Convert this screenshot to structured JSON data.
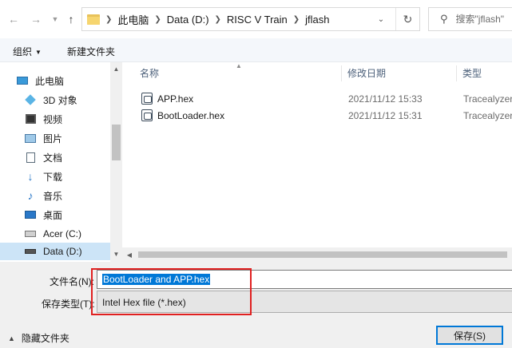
{
  "address": {
    "breadcrumbs": [
      "此电脑",
      "Data (D:)",
      "RISC V Train",
      "jflash"
    ],
    "search_placeholder": "搜索\"jflash\""
  },
  "toolbar": {
    "organize_label": "组织",
    "new_folder_label": "新建文件夹"
  },
  "nav": {
    "items": [
      {
        "label": "此电脑",
        "icon": "computer-icon"
      },
      {
        "label": "3D 对象",
        "icon": "cube-icon"
      },
      {
        "label": "视频",
        "icon": "video-icon"
      },
      {
        "label": "图片",
        "icon": "picture-icon"
      },
      {
        "label": "文档",
        "icon": "document-icon"
      },
      {
        "label": "下载",
        "icon": "download-icon"
      },
      {
        "label": "音乐",
        "icon": "music-icon"
      },
      {
        "label": "桌面",
        "icon": "desktop-icon"
      },
      {
        "label": "Acer (C:)",
        "icon": "drive-icon"
      },
      {
        "label": "Data (D:)",
        "icon": "drive-icon"
      }
    ],
    "selected_index": 9
  },
  "columns": {
    "name": "名称",
    "modified": "修改日期",
    "type": "类型"
  },
  "files": [
    {
      "name": "APP.hex",
      "modified": "2021/11/12 15:33",
      "type": "Tracealyzer"
    },
    {
      "name": "BootLoader.hex",
      "modified": "2021/11/12 15:31",
      "type": "Tracealyzer"
    }
  ],
  "form": {
    "filename_label": "文件名(N):",
    "filename_value": "BootLoader and APP.hex",
    "filetype_label": "保存类型(T):",
    "filetype_value": "Intel Hex file (*.hex)",
    "hide_folders_label": "隐藏文件夹",
    "save_label": "保存(S)"
  },
  "colors": {
    "accent": "#0078d7",
    "selection": "#cce4f7",
    "highlight_frame": "#e02020"
  }
}
